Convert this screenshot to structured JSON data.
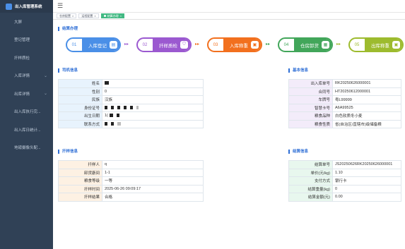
{
  "app": {
    "title": "出入库管理系统"
  },
  "sidebar": {
    "items": [
      {
        "label": "大屏",
        "has_children": false
      },
      {
        "label": "登记管理",
        "has_children": false
      },
      {
        "label": "扦样质检",
        "has_children": false
      },
      {
        "label": "入库详情",
        "has_children": true
      },
      {
        "label": "出库详情",
        "has_children": true
      },
      {
        "label": "出入库执行完...",
        "has_children": false
      },
      {
        "label": "出入库日统计...",
        "has_children": false
      },
      {
        "label": "地磅摄像头配...",
        "has_children": false
      }
    ]
  },
  "tags": [
    {
      "label": "仓房配置",
      "active": false
    },
    {
      "label": "运程配置",
      "active": false
    },
    {
      "label": "结算办理",
      "active": true
    }
  ],
  "sections": {
    "steps_title": "结算办理",
    "driver_title": "司机信息",
    "base_title": "基本信息",
    "sampling_title": "扦样信息",
    "settlement_title": "结算信息"
  },
  "steps": [
    {
      "num": "01",
      "label": "入库登记",
      "color": "#4a8fe7",
      "icon": "doc-icon"
    },
    {
      "num": "02",
      "label": "扦样质检",
      "color": "#9b59d0",
      "icon": "shield-icon"
    },
    {
      "num": "03",
      "label": "入库称重",
      "color": "#f2701e",
      "icon": "scale-icon"
    },
    {
      "num": "04",
      "label": "仓房卸货",
      "color": "#42a65a",
      "icon": "truck-icon"
    },
    {
      "num": "05",
      "label": "出库称重",
      "color": "#9dbb2e",
      "icon": "scale-icon"
    }
  ],
  "driver": {
    "rows": [
      {
        "label": "姓名",
        "value": "",
        "redacted": true
      },
      {
        "label": "性别",
        "value": "0"
      },
      {
        "label": "民族",
        "value": "汉族"
      },
      {
        "label": "身份证号",
        "value": "",
        "redacted": true
      },
      {
        "label": "出生日期",
        "value": "1(",
        "redacted": true
      },
      {
        "label": "联系方式",
        "value": "",
        "redacted": true
      }
    ]
  },
  "base": {
    "rows": [
      {
        "label": "出入库单号",
        "value": "RK20250626000001"
      },
      {
        "label": "合同号",
        "value": "HT20250612000001"
      },
      {
        "label": "车牌号",
        "value": "粤L99999"
      },
      {
        "label": "智慧卡号",
        "value": "A6A99525"
      },
      {
        "label": "粮食品种",
        "value": "白色软质冬小麦"
      },
      {
        "label": "粮食性质",
        "value": "省(自治区/直辖市)级储备粮"
      }
    ]
  },
  "sampling": {
    "rows": [
      {
        "label": "扦样人",
        "value": "q"
      },
      {
        "label": "卸货廒间",
        "value": "1-1"
      },
      {
        "label": "粮食等级",
        "value": "一等"
      },
      {
        "label": "扦样时间",
        "value": "2025-06-26 09:09:17"
      },
      {
        "label": "扦样结果",
        "value": "合格"
      }
    ]
  },
  "settlement": {
    "rows": [
      {
        "label": "结算单号",
        "value": "JS20250626RK20250626000001"
      },
      {
        "label": "单价(元/kg)",
        "value": "1.10"
      },
      {
        "label": "支付方式",
        "value": "银行卡"
      },
      {
        "label": "结算重量(kg)",
        "value": "0"
      },
      {
        "label": "结算金额(元)",
        "value": "0.00"
      }
    ]
  }
}
